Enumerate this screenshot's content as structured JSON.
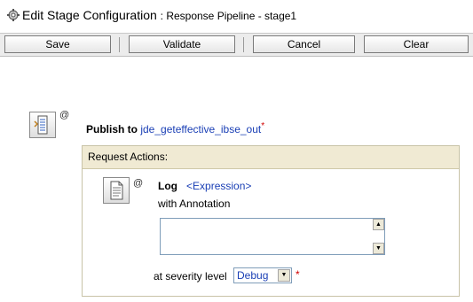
{
  "header": {
    "title": "Edit Stage Configuration",
    "subtitle": ": Response Pipeline - stage1"
  },
  "toolbar": {
    "save_label": "Save",
    "validate_label": "Validate",
    "cancel_label": "Cancel",
    "clear_label": "Clear"
  },
  "stage": {
    "publish_prefix": "Publish to",
    "target": "jde_geteffective_ibse_out",
    "required_mark": "*",
    "at_symbol": "@"
  },
  "actions": {
    "header": "Request Actions:",
    "log_label": "Log",
    "expression_link": "<Expression>",
    "annotation_label": "with Annotation",
    "annotation_value": "",
    "severity_label": "at severity level",
    "severity_value": "Debug",
    "severity_required": "*",
    "at_symbol": "@"
  },
  "icons": {
    "title": "gear-cog-icon",
    "stage": "publish-stage-icon",
    "log": "document-icon"
  },
  "colors": {
    "link": "#1a3fb5",
    "required": "#d00000",
    "actions_header_bg": "#f0ead3"
  }
}
